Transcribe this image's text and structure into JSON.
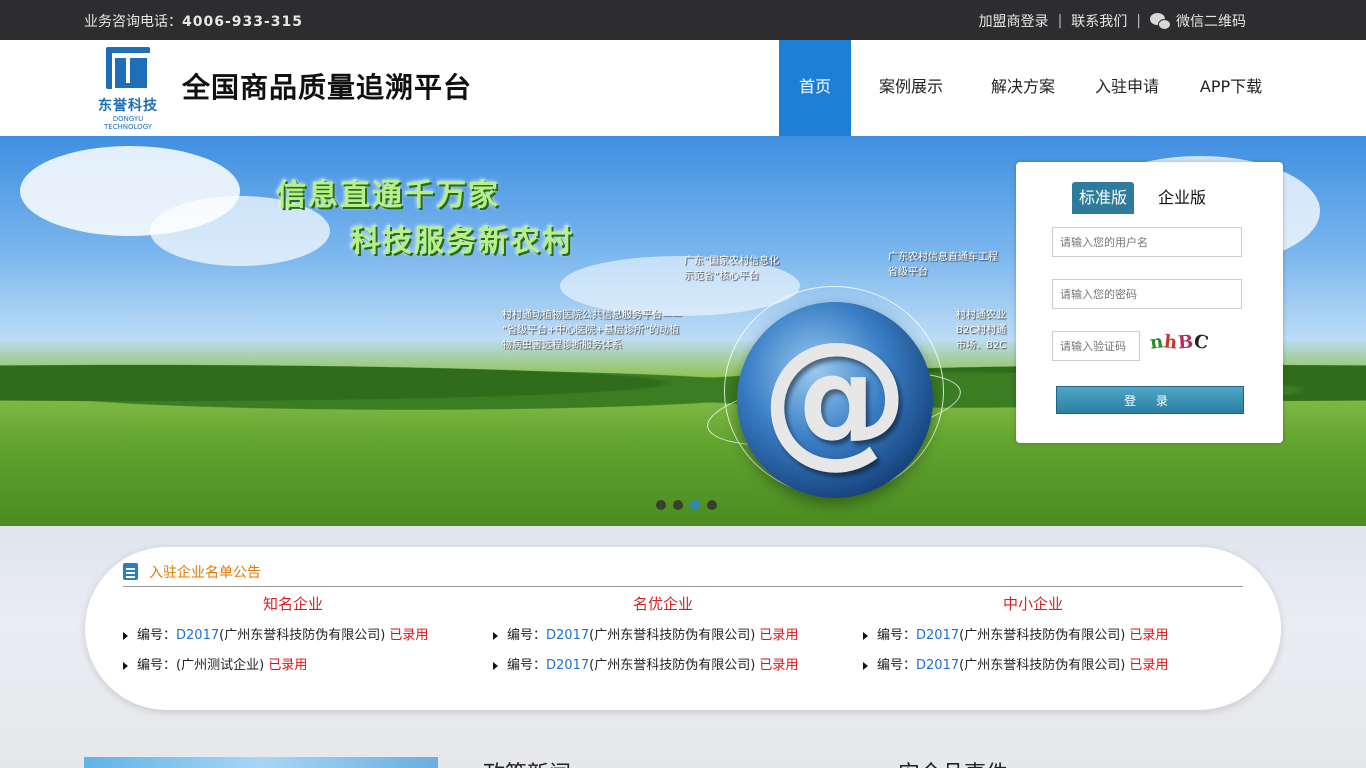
{
  "topbar": {
    "phone_label": "业务咨询电话：",
    "phone_number": "4006-933-315",
    "links": [
      "加盟商登录",
      "联系我们",
      "微信二维码"
    ],
    "separator": "|"
  },
  "header": {
    "logo_name": "东誉科技",
    "logo_en": "DONGYU TECHNOLOGY",
    "site_title": "全国商品质量追溯平台",
    "nav": [
      {
        "label": "首页",
        "active": true
      },
      {
        "label": "案例展示",
        "active": false
      },
      {
        "label": "解决方案",
        "active": false
      },
      {
        "label": "入驻申请",
        "active": false
      },
      {
        "label": "APP下载",
        "active": false
      }
    ]
  },
  "banner": {
    "slogan_line1": "信息直通千万家",
    "slogan_line2": "科技服务新农村",
    "blurbs": [
      "广东“国家农村信息化\n示范省”核心平台",
      "广东农村信息直通车工程\n省级平台",
      "村村通动植物医院公共信息服务平台——\n“省级平台+中心医院+基层诊所”的动植\n物病虫害远程诊断服务体系",
      "村村通农业\nB2C村村通\n市场、B2C"
    ],
    "at_symbol": "@",
    "slide_count": 4,
    "active_slide": 3
  },
  "login": {
    "tabs": [
      "标准版",
      "企业版"
    ],
    "active_tab": 0,
    "username_placeholder": "请输入您的用户名",
    "password_placeholder": "请输入您的密码",
    "captcha_placeholder": "请输入验证码",
    "captcha_chars": [
      "n",
      "h",
      "B",
      "C"
    ],
    "captcha_colors": [
      "#2a8a2a",
      "#c0392b",
      "#b03060",
      "#222222"
    ],
    "submit_label": "登 录"
  },
  "notice": {
    "title": "入驻企业名单公告",
    "code_prefix": "编号：",
    "columns": [
      {
        "heading": "知名企业",
        "rows": [
          {
            "code": "D2017",
            "company": "(广州东誉科技防伪有限公司)",
            "status": "已录用"
          },
          {
            "code": "",
            "company": "(广州测试企业)",
            "status": "已录用"
          }
        ]
      },
      {
        "heading": "名优企业",
        "rows": [
          {
            "code": "D2017",
            "company": "(广州东誉科技防伪有限公司)",
            "status": "已录用"
          },
          {
            "code": "D2017",
            "company": "(广州东誉科技防伪有限公司)",
            "status": "已录用"
          }
        ]
      },
      {
        "heading": "中小企业",
        "rows": [
          {
            "code": "D2017",
            "company": "(广州东誉科技防伪有限公司)",
            "status": "已录用"
          },
          {
            "code": "D2017",
            "company": "(广州东誉科技防伪有限公司)",
            "status": "已录用"
          }
        ]
      }
    ]
  },
  "sections": {
    "policy_news": "政策新闻",
    "safety_events": "安全品事件"
  },
  "colors": {
    "topbar": "#2d2d30",
    "nav_active": "#1e7fd6",
    "login_tab": "#2d7c9c",
    "notice_title": "#e07a00",
    "heading_red": "#d42222",
    "code_blue": "#1f6fcf",
    "status_red": "#e01010"
  }
}
